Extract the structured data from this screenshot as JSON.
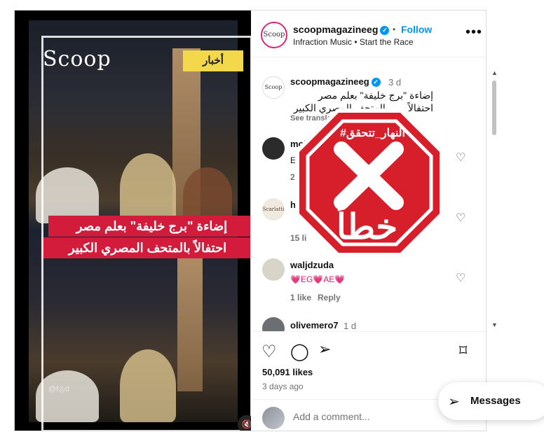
{
  "media": {
    "logo": "Scoop",
    "news_tag": "أخبار",
    "caption_line1": "إضاءة \"برج خليفة\" بعلم مصر",
    "caption_line2": "احتفالاً بالمتحف المصري الكبير",
    "watermark": "@f◎d"
  },
  "header": {
    "username": "scoopmagazineeg",
    "follow": "Follow",
    "subtitle": "Infraction Music • Start the Race",
    "avatar_text": "Scoop"
  },
  "post": {
    "username": "scoopmagazineeg",
    "time": "3 d",
    "caption_line1": "إضاءة \"برج خليفة\" بعلم مصر احتفالاً",
    "caption_line2": "بالمتحف المصري الكبير",
    "see_translation": "See translation"
  },
  "comments": [
    {
      "user": "moha",
      "text": "EG",
      "meta": "2",
      "avatar_color": "#2b2b2b"
    },
    {
      "user": "h",
      "text": "",
      "meta": "15 li",
      "avatar_color": "#efe9df",
      "avatar_text": "Scarlatti"
    },
    {
      "user": "waljdzuda",
      "text": "💗EG💗AE💗",
      "meta_likes": "1 like",
      "meta_reply": "Reply",
      "avatar_color": "#d8d4c8"
    },
    {
      "user": "olivemero7",
      "time": "1 d",
      "avatar_color": "#6b6e73"
    }
  ],
  "actions": {
    "likes": "50,091 likes",
    "ago": "3 days ago",
    "add_comment_placeholder": "Add a comment..."
  },
  "stamp": {
    "hashtag": "#النهار_تتحقق",
    "word": "خطأ",
    "color": "#d71f2b"
  },
  "messages": {
    "label": "Messages"
  }
}
